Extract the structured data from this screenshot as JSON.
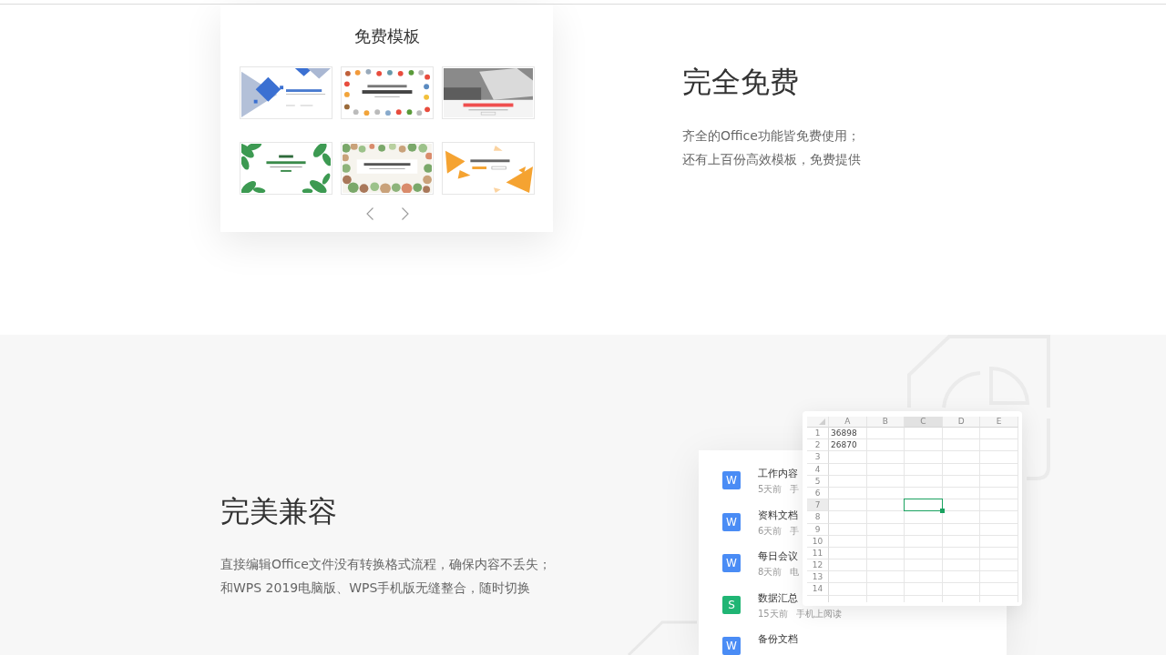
{
  "templates_card": {
    "title": "免费模板",
    "templates": [
      {
        "kind": "diamonds"
      },
      {
        "kind": "doodles"
      },
      {
        "kind": "photo"
      },
      {
        "kind": "leaves"
      },
      {
        "kind": "floral"
      },
      {
        "kind": "triangles"
      }
    ]
  },
  "feature_free": {
    "heading": "完全免费",
    "lines": [
      "齐全的Office功能皆免费使用；",
      "还有上百份高效模板，免费提供"
    ]
  },
  "feature_compat": {
    "heading": "完美兼容",
    "lines": [
      "直接编辑Office文件没有转换格式流程，确保内容不丢失；",
      "和WPS 2019电脑版、WPS手机版无缝整合，随时切换"
    ]
  },
  "recent_files": {
    "items": [
      {
        "badge": "W",
        "color": "#4a8cf5",
        "title": "工作内容",
        "time": "5天前",
        "source": "手"
      },
      {
        "badge": "W",
        "color": "#4a8cf5",
        "title": "资料文档",
        "time": "6天前",
        "source": "手"
      },
      {
        "badge": "W",
        "color": "#4a8cf5",
        "title": "每日会议",
        "time": "8天前",
        "source": "电"
      },
      {
        "badge": "S",
        "color": "#20b574",
        "title": "数据汇总",
        "time": "15天前",
        "source": "手机上阅读"
      },
      {
        "badge": "W",
        "color": "#4a8cf5",
        "title": "备份文档"
      }
    ]
  },
  "sheet": {
    "columns": [
      {
        "label": "A",
        "selected": false
      },
      {
        "label": "B",
        "selected": false
      },
      {
        "label": "C",
        "selected": true
      },
      {
        "label": "D",
        "selected": false
      },
      {
        "label": "E",
        "selected": false
      }
    ],
    "rows": [
      {
        "label": "1",
        "selected": false,
        "values": [
          "36898"
        ]
      },
      {
        "label": "2",
        "selected": false,
        "values": [
          "26870"
        ]
      },
      {
        "label": "3",
        "selected": false
      },
      {
        "label": "4",
        "selected": false
      },
      {
        "label": "5",
        "selected": false
      },
      {
        "label": "6",
        "selected": false
      },
      {
        "label": "7",
        "selected": true
      },
      {
        "label": "8",
        "selected": false
      },
      {
        "label": "9",
        "selected": false
      },
      {
        "label": "10",
        "selected": false
      },
      {
        "label": "11",
        "selected": false
      },
      {
        "label": "12",
        "selected": false
      },
      {
        "label": "13",
        "selected": false
      },
      {
        "label": "14",
        "selected": false
      }
    ]
  }
}
